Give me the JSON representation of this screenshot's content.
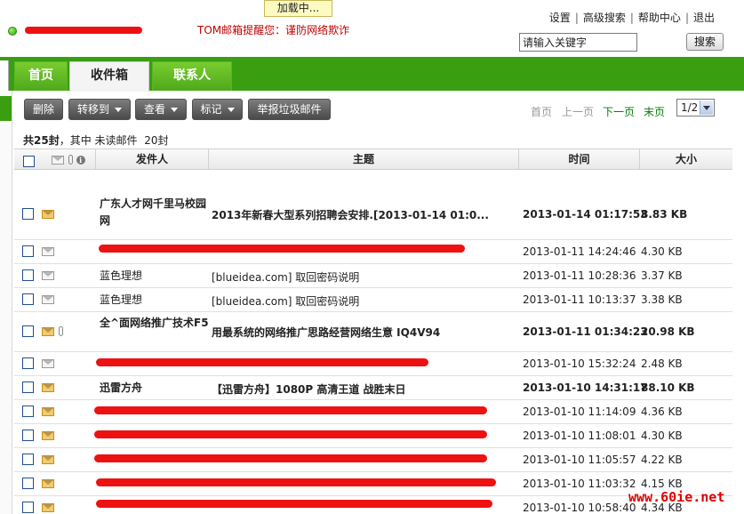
{
  "loading": "加载中...",
  "account": {
    "username": "",
    "alert": "TOM邮箱提醒您：谨防网络欺诈"
  },
  "toplinks": [
    "设置",
    "高级搜索",
    "帮助中心",
    "退出"
  ],
  "search": {
    "value": "请输入关键字",
    "button": "搜索"
  },
  "tabs": [
    "首页",
    "收件箱",
    "联系人"
  ],
  "toolbar": {
    "delete": "删除",
    "move": "转移到",
    "view": "查看",
    "mark": "标记",
    "spam": "举报垃圾邮件"
  },
  "pager": {
    "first": "首页",
    "prev": "上一页",
    "next": "下一页",
    "last": "末页",
    "page": "1/2"
  },
  "summary": {
    "total": "共25封",
    "middle": "，其中",
    "unread_label": "未读邮件",
    "unread_count": "20封"
  },
  "columns": {
    "sender": "发件人",
    "subject": "主题",
    "time": "时间",
    "size": "大小"
  },
  "rows": [
    {
      "sender": "广东人才网千里马校园网",
      "subject": "2013年新春大型系列招聘会安排.[2013-01-14 01:0...",
      "time": "2013-01-14 01:17:53",
      "size": "8.83 KB"
    },
    {
      "sender": "",
      "subject": "",
      "time": "2013-01-11 14:24:46",
      "size": "4.30 KB"
    },
    {
      "sender": "蓝色理想",
      "subject": "[blueidea.com] 取回密码说明",
      "time": "2013-01-11 10:28:36",
      "size": "3.37 KB"
    },
    {
      "sender": "蓝色理想",
      "subject": "[blueidea.com] 取回密码说明",
      "time": "2013-01-11 10:13:37",
      "size": "3.38 KB"
    },
    {
      "sender": "全^面网络推广技术F5",
      "subject": "用最系统的网络推广思路经营网络生意 IQ4V94",
      "time": "2013-01-11 01:34:23",
      "size": "20.98 KB"
    },
    {
      "sender": "",
      "subject": "",
      "time": "2013-01-10 15:32:24",
      "size": "2.48 KB"
    },
    {
      "sender": "迅雷方舟",
      "subject": "【迅雷方舟】1080P 高清王道 战胜末日",
      "time": "2013-01-10 14:31:17",
      "size": "88.10 KB"
    },
    {
      "sender": "",
      "subject": "",
      "time": "2013-01-10 11:14:09",
      "size": "4.36 KB"
    },
    {
      "sender": "",
      "subject": "",
      "time": "2013-01-10 11:08:01",
      "size": "4.30 KB"
    },
    {
      "sender": "",
      "subject": "",
      "time": "2013-01-10 11:05:57",
      "size": "4.22 KB"
    },
    {
      "sender": "",
      "subject": "",
      "time": "2013-01-10 11:03:32",
      "size": "4.15 KB"
    },
    {
      "sender": "",
      "subject": "",
      "time": "2013-01-10 10:58:40",
      "size": "4.34 KB"
    }
  ],
  "watermark": "www.60ie.net",
  "colors": {
    "nav_green": "#3a9e11",
    "redaction": "#ee1111",
    "link_green": "#0a7e0a"
  }
}
